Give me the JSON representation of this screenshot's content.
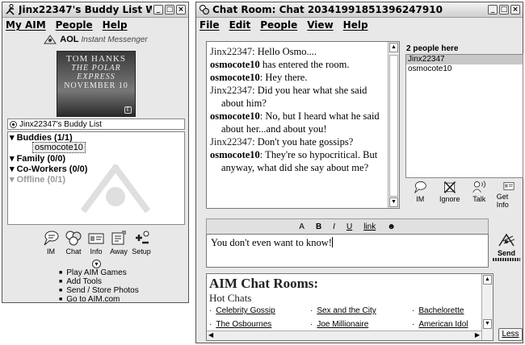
{
  "buddy_window": {
    "title": "Jinx22347's Buddy List Wi...",
    "menu": [
      "My AIM",
      "People",
      "Help"
    ],
    "logo_brand": "AOL",
    "logo_text": "Instant Messenger",
    "ad": {
      "line1": "TOM HANKS",
      "line2": "THE POLAR EXPRESS",
      "line3": "NOVEMBER 10"
    },
    "list_selector": "Jinx22347's Buddy List",
    "groups": [
      {
        "label": "Buddies (1/1)",
        "buddies": [
          "osmocote10"
        ]
      },
      {
        "label": "Family (0/0)",
        "buddies": []
      },
      {
        "label": "Co-Workers (0/0)",
        "buddies": []
      },
      {
        "label": "Offline (0/1)",
        "buddies": []
      }
    ],
    "toolbar": [
      {
        "icon": "im-icon",
        "label": "IM"
      },
      {
        "icon": "chat-icon",
        "label": "Chat"
      },
      {
        "icon": "info-icon",
        "label": "Info"
      },
      {
        "icon": "away-icon",
        "label": "Away"
      },
      {
        "icon": "setup-icon",
        "label": "Setup"
      }
    ],
    "links": [
      "Play AIM Games",
      "Add Tools",
      "Send / Store Photos",
      "Go to AIM.com"
    ]
  },
  "chat_window": {
    "title": "Chat Room: Chat 20341991851396247910",
    "menu": [
      "File",
      "Edit",
      "People",
      "View",
      "Help"
    ],
    "messages": [
      {
        "who": "Jinx22347",
        "sep": ":",
        "text": " Hello Osmo....",
        "bold": false
      },
      {
        "who": "osmocote10",
        "sep": "",
        "text": " has entered the room.",
        "bold": true
      },
      {
        "who": "osmocote10",
        "sep": ":",
        "text": " Hey there.",
        "bold": true
      },
      {
        "who": "Jinx22347",
        "sep": ":",
        "text": " Did you hear what she said about him?",
        "bold": false
      },
      {
        "who": "osmocote10",
        "sep": ":",
        "text": " No, but I heard what he said about her...and about you!",
        "bold": true
      },
      {
        "who": "Jinx22347",
        "sep": ":",
        "text": " Don't you hate gossips?",
        "bold": false
      },
      {
        "who": "osmocote10",
        "sep": ":",
        "text": " They're so hypocritical. But anyway, what did she say about me?",
        "bold": true
      }
    ],
    "people_title": "2 people here",
    "people": [
      "Jinx22347",
      "osmocote10"
    ],
    "people_tools": [
      {
        "icon": "im-icon",
        "label": "IM"
      },
      {
        "icon": "ignore-icon",
        "label": "Ignore"
      },
      {
        "icon": "talk-icon",
        "label": "Talk"
      },
      {
        "icon": "get-info-icon",
        "label": "Get Info"
      }
    ],
    "format": {
      "font_size": "A",
      "bold": "B",
      "italic": "I",
      "underline": "U",
      "link": "link",
      "smiley": "☻"
    },
    "input_value": "You don't even want to know!",
    "send_label": "Send",
    "rooms_title": "AIM Chat Rooms:",
    "rooms_subtitle": "Hot Chats",
    "rooms": [
      [
        "Celebrity Gossip",
        "Sex and the City",
        "Bachelorette"
      ],
      [
        "The Osbournes",
        "Joe Millionaire",
        "American Idol"
      ]
    ],
    "less_label": "Less"
  }
}
